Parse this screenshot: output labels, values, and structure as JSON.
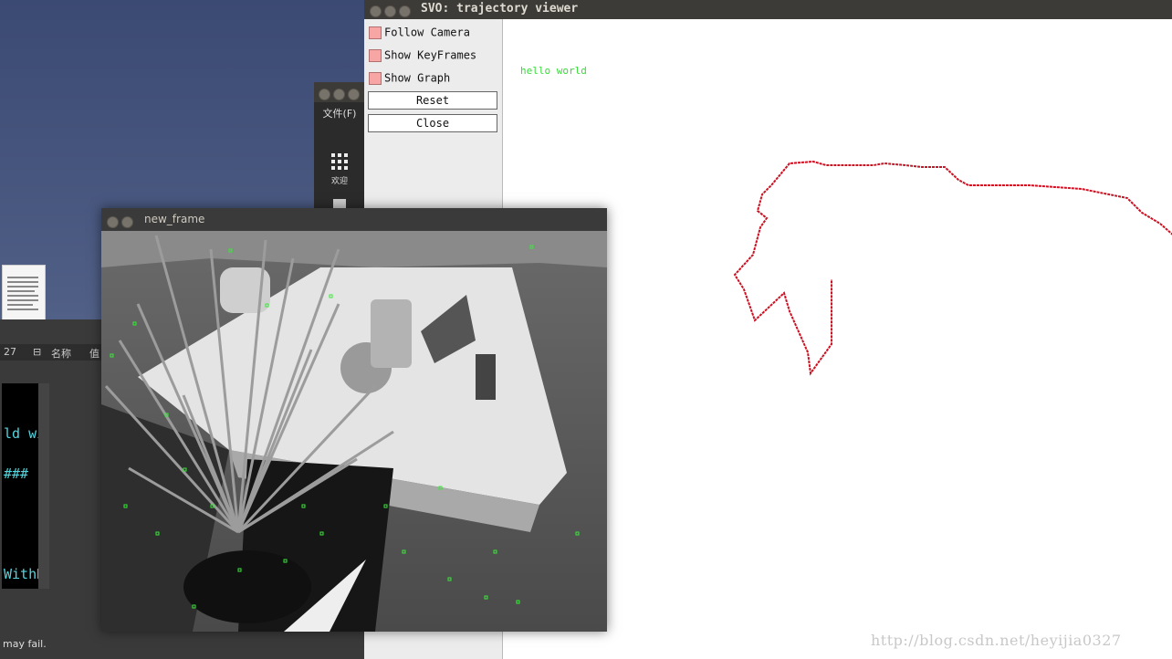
{
  "svo_window": {
    "title": "SVO: trajectory viewer",
    "controls": [
      {
        "label": "Follow Camera",
        "checked": false
      },
      {
        "label": "Show KeyFrames",
        "checked": false
      },
      {
        "label": "Show Graph",
        "checked": false
      }
    ],
    "reset_label": "Reset",
    "close_label": "Close",
    "canvas_text": "hello world",
    "trajectory_color": "#cc1122",
    "camera_color": "#22dd22",
    "watermark": "http://blog.csdn.net/heyijia0327"
  },
  "file_manager": {
    "menu_label": "文件(F)",
    "welcome_label": "欢迎"
  },
  "editor": {
    "line_number": "27",
    "col_name": "名称",
    "col_value": "值",
    "lines": [
      "ld wit",
      "###",
      "WithD"
    ],
    "status": "may fail."
  },
  "image_window": {
    "title": "new_frame",
    "feature_color": "#33ee33"
  }
}
